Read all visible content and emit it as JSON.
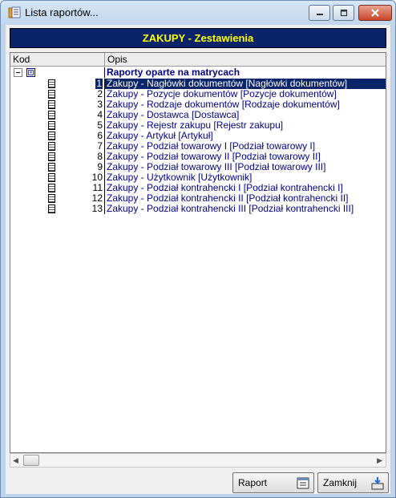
{
  "window": {
    "title": "Lista raportów...",
    "icon": "report-list-icon"
  },
  "header": {
    "title": "ZAKUPY - Zestawienia"
  },
  "grid": {
    "columns": {
      "kod": "Kod",
      "opis": "Opis"
    },
    "group": {
      "label": "Raporty oparte na matrycach"
    },
    "rows": [
      {
        "num": "1",
        "opis": "Zakupy - Nagłówki dokumentów [Nagłówki dokumentów]",
        "selected": true
      },
      {
        "num": "2",
        "opis": "Zakupy - Pozycje dokumentów [Pozycje dokumentów]"
      },
      {
        "num": "3",
        "opis": "Zakupy - Rodzaje dokumentów [Rodzaje dokumentów]"
      },
      {
        "num": "4",
        "opis": "Zakupy - Dostawca [Dostawca]"
      },
      {
        "num": "5",
        "opis": "Zakupy - Rejestr zakupu [Rejestr zakupu]"
      },
      {
        "num": "6",
        "opis": "Zakupy - Artykuł [Artykuł]"
      },
      {
        "num": "7",
        "opis": "Zakupy - Podział towarowy I [Podział towarowy I]"
      },
      {
        "num": "8",
        "opis": "Zakupy - Podział towarowy II [Podział towarowy II]"
      },
      {
        "num": "9",
        "opis": "Zakupy - Podział towarowy III [Podział towarowy III]"
      },
      {
        "num": "10",
        "opis": "Zakupy - Użytkownik [Użytkownik]"
      },
      {
        "num": "11",
        "opis": "Zakupy - Podział kontrahencki I [Podział kontrahencki I]"
      },
      {
        "num": "12",
        "opis": "Zakupy - Podział kontrahencki II [Podział kontrahencki II]"
      },
      {
        "num": "13",
        "opis": "Zakupy - Podział kontrahencki III [Podział kontrahencki III]"
      }
    ]
  },
  "buttons": {
    "raport": "Raport",
    "zamknij": "Zamknij"
  },
  "colors": {
    "header_bg": "#0a246a",
    "header_text": "#ffff00",
    "link_text": "#00008b",
    "selected_bg": "#0a246a"
  }
}
